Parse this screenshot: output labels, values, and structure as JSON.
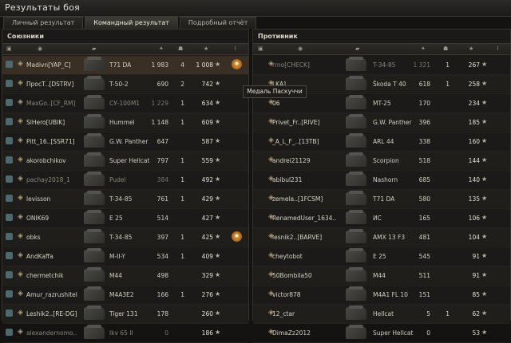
{
  "window": {
    "title": "Результаты боя"
  },
  "tabs": [
    {
      "label": "Личный результат"
    },
    {
      "label": "Командный результат"
    },
    {
      "label": "Подробный отчёт"
    }
  ],
  "allies": {
    "title": "Союзники",
    "rows": [
      {
        "name": "Madivn[YAP_C]",
        "tier": "",
        "tank": "T71 DA",
        "damage": "1 983",
        "kills": "4",
        "xp": "1 008",
        "medal": true
      },
      {
        "name": "ПросТ..[DSTRV]",
        "tier": "",
        "tank": "T-50-2",
        "damage": "690",
        "kills": "2",
        "xp": "742"
      },
      {
        "name": "MaxGo..[CF_RM]",
        "tier": "",
        "tank": "СУ-100М1",
        "damage": "1 229",
        "kills": "1",
        "xp": "634"
      },
      {
        "name": "SlHero[UBIK]",
        "tier": "",
        "tank": "Hummel",
        "damage": "1 148",
        "kills": "1",
        "xp": "609"
      },
      {
        "name": "Pitt_16..[SSR71]",
        "tier": "",
        "tank": "G.W. Panther",
        "damage": "647",
        "kills": "",
        "xp": "587"
      },
      {
        "name": "akorobchikov",
        "tier": "",
        "tank": "Super Hellcat",
        "damage": "797",
        "kills": "1",
        "xp": "559"
      },
      {
        "name": "pachay2018_1",
        "tier": "",
        "tank": "Pudel",
        "damage": "384",
        "kills": "1",
        "xp": "492"
      },
      {
        "name": "levisson",
        "tier": "",
        "tank": "T-34-85",
        "damage": "761",
        "kills": "1",
        "xp": "429"
      },
      {
        "name": "ONIK69",
        "tier": "",
        "tank": "E 25",
        "damage": "514",
        "kills": "",
        "xp": "427"
      },
      {
        "name": "obks",
        "tier": "",
        "tank": "T-34-85",
        "damage": "397",
        "kills": "1",
        "xp": "425",
        "medal": true
      },
      {
        "name": "AndKaffa",
        "tier": "",
        "tank": "M-II-Y",
        "damage": "534",
        "kills": "1",
        "xp": "409"
      },
      {
        "name": "chermetchik",
        "tier": "",
        "tank": "M44",
        "damage": "498",
        "kills": "",
        "xp": "329"
      },
      {
        "name": "Amur_razrushitel",
        "tier": "",
        "tank": "M4A3E2",
        "damage": "166",
        "kills": "1",
        "xp": "276"
      },
      {
        "name": "Leshik2..[RE-DG]",
        "tier": "",
        "tank": "Tiger 131",
        "damage": "178",
        "kills": "",
        "xp": "260"
      },
      {
        "name": "alexandernomo..",
        "tier": "",
        "tank": "Ikv 65 II",
        "damage": "0",
        "kills": "",
        "xp": "186"
      }
    ]
  },
  "enemies": {
    "title": "Противник",
    "rows": [
      {
        "name": "rrno[CHECK]",
        "tier": "",
        "tank": "T-34-85",
        "damage": "1 321",
        "kills": "1",
        "xp": "267"
      },
      {
        "name": "LKA]",
        "tier": "",
        "tank": "Škoda T 40",
        "damage": "618",
        "kills": "1",
        "xp": "258"
      },
      {
        "name": "06",
        "tier": "",
        "tank": "MT-25",
        "damage": "170",
        "kills": "",
        "xp": "234"
      },
      {
        "name": "Privet_Fr..[RIVE]",
        "tier": "",
        "tank": "G.W. Panther",
        "damage": "396",
        "kills": "",
        "xp": "185"
      },
      {
        "name": "_A_L_F_..[13TB]",
        "tier": "",
        "tank": "ARL 44",
        "damage": "338",
        "kills": "",
        "xp": "160"
      },
      {
        "name": "andrei21129",
        "tier": "",
        "tank": "Scorpion",
        "damage": "518",
        "kills": "",
        "xp": "144"
      },
      {
        "name": "abibul231",
        "tier": "",
        "tank": "Nashorn",
        "damage": "685",
        "kills": "",
        "xp": "140"
      },
      {
        "name": "zemela..[1FCSM]",
        "tier": "",
        "tank": "T71 DA",
        "damage": "580",
        "kills": "",
        "xp": "135"
      },
      {
        "name": "RenamedUser_1634..",
        "tier": "",
        "tank": "ИС",
        "damage": "165",
        "kills": "",
        "xp": "106"
      },
      {
        "name": "lesnik2..[BARVE]",
        "tier": "",
        "tank": "AMX 13 F3",
        "damage": "481",
        "kills": "",
        "xp": "104"
      },
      {
        "name": "cheytobot",
        "tier": "",
        "tank": "E 25",
        "damage": "545",
        "kills": "",
        "xp": "91"
      },
      {
        "name": "50Bombila50",
        "tier": "",
        "tank": "M44",
        "damage": "511",
        "kills": "",
        "xp": "91"
      },
      {
        "name": "victor878",
        "tier": "",
        "tank": "M4A1 FL 10",
        "damage": "151",
        "kills": "",
        "xp": "85"
      },
      {
        "name": "12_ctar",
        "tier": "",
        "tank": "Hellcat",
        "damage": "5",
        "kills": "1",
        "xp": "62"
      },
      {
        "name": "DimaZz2012",
        "tier": "",
        "tank": "Super Hellcat",
        "damage": "0",
        "kills": "",
        "xp": "53"
      }
    ]
  },
  "tooltip": {
    "text": "Медаль Паскуччи"
  }
}
